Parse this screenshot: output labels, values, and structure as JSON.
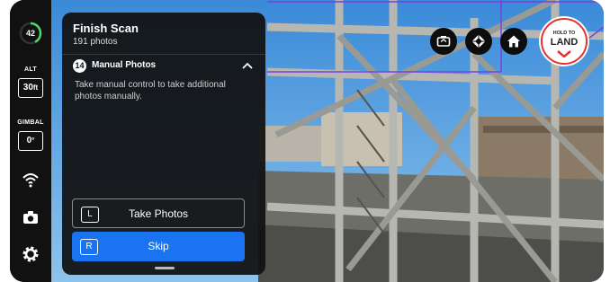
{
  "status": {
    "battery_percent": "42",
    "battery_level": 0.42,
    "altitude_label": "ALT",
    "altitude_value": "30",
    "altitude_unit": "ft",
    "gimbal_label": "GIMBAL",
    "gimbal_value": "0",
    "gimbal_unit": "°"
  },
  "panel": {
    "title": "Finish Scan",
    "subtitle": "191 photos",
    "step_number": "14",
    "step_title": "Manual Photos",
    "description": "Take manual control to take additional photos manually.",
    "take_photos_key": "L",
    "take_photos_label": "Take Photos",
    "skip_key": "R",
    "skip_label": "Skip"
  },
  "controls": {
    "land_hint": "HOLD TO",
    "land_label": "LAND"
  },
  "colors": {
    "accent_blue": "#1a73f0",
    "land_red": "#e5322e",
    "battery_green": "#4cd964",
    "battery_red": "#e5322e"
  },
  "icons": [
    "wifi-icon",
    "camera-icon",
    "settings-gear-icon",
    "chevron-up-icon",
    "camera-switch-icon",
    "dpad-icon",
    "home-icon",
    "chevron-down-icon"
  ]
}
